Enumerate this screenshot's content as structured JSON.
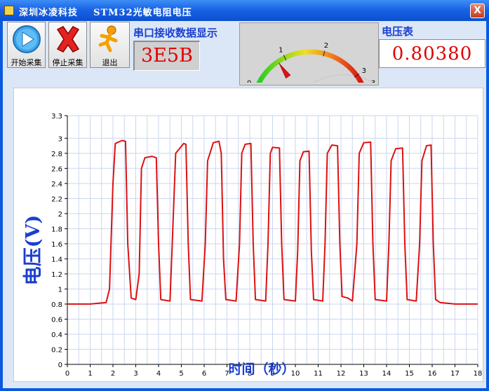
{
  "window": {
    "title": "深圳冰凌科技    STM32光敏电阻电压",
    "close_label": "X"
  },
  "toolbar": {
    "start_label": "开始采集",
    "stop_label": "停止采集",
    "exit_label": "退出"
  },
  "serial": {
    "heading": "串口接收数据显示",
    "value": "3E5B"
  },
  "meter": {
    "ticks": [
      "0",
      "1",
      "2",
      "3",
      "3.3"
    ],
    "min": 0,
    "max": 3.3,
    "value": 0.8038
  },
  "voltage": {
    "heading": "电压表",
    "value": "0.80380"
  },
  "colors": {
    "trace": "#dd1111",
    "axis_title": "#1a3fcf",
    "value_text": "#e10000"
  },
  "chart_data": {
    "type": "line",
    "xlabel": "时间（秒）",
    "ylabel": "电压(V)",
    "xlim": [
      0,
      18
    ],
    "ylim": [
      0,
      3.3
    ],
    "x_ticks": [
      "0",
      "1",
      "2",
      "3",
      "4",
      "5",
      "6",
      "7",
      "8",
      "9",
      "10",
      "11",
      "12",
      "13",
      "14",
      "15",
      "16",
      "17",
      "18"
    ],
    "y_ticks": [
      "0",
      "0.2",
      "0.4",
      "0.6",
      "0.8",
      "1",
      "1.2",
      "1.4",
      "1.6",
      "1.8",
      "2",
      "2.2",
      "2.4",
      "2.6",
      "2.8",
      "3",
      "3.3"
    ],
    "grid": true,
    "series": [
      {
        "points": [
          [
            0,
            0.8
          ],
          [
            1.0,
            0.8
          ],
          [
            1.7,
            0.82
          ],
          [
            1.85,
            1.0
          ],
          [
            2.0,
            2.4
          ],
          [
            2.1,
            2.93
          ],
          [
            2.4,
            2.97
          ],
          [
            2.55,
            2.96
          ],
          [
            2.65,
            1.6
          ],
          [
            2.8,
            0.88
          ],
          [
            3.0,
            0.86
          ],
          [
            3.15,
            1.2
          ],
          [
            3.25,
            2.6
          ],
          [
            3.4,
            2.74
          ],
          [
            3.7,
            2.76
          ],
          [
            3.9,
            2.74
          ],
          [
            4.0,
            1.6
          ],
          [
            4.1,
            0.86
          ],
          [
            4.5,
            0.84
          ],
          [
            4.6,
            1.6
          ],
          [
            4.75,
            2.8
          ],
          [
            5.1,
            2.93
          ],
          [
            5.2,
            2.92
          ],
          [
            5.3,
            1.6
          ],
          [
            5.4,
            0.86
          ],
          [
            5.9,
            0.84
          ],
          [
            6.05,
            1.6
          ],
          [
            6.15,
            2.7
          ],
          [
            6.4,
            2.94
          ],
          [
            6.65,
            2.96
          ],
          [
            6.75,
            2.8
          ],
          [
            6.85,
            1.4
          ],
          [
            6.95,
            0.86
          ],
          [
            7.4,
            0.84
          ],
          [
            7.55,
            1.6
          ],
          [
            7.65,
            2.8
          ],
          [
            7.8,
            2.92
          ],
          [
            8.05,
            2.93
          ],
          [
            8.15,
            1.6
          ],
          [
            8.25,
            0.86
          ],
          [
            8.7,
            0.84
          ],
          [
            8.8,
            1.6
          ],
          [
            8.9,
            2.8
          ],
          [
            9.0,
            2.88
          ],
          [
            9.3,
            2.87
          ],
          [
            9.4,
            1.6
          ],
          [
            9.5,
            0.86
          ],
          [
            10.0,
            0.84
          ],
          [
            10.1,
            1.5
          ],
          [
            10.2,
            2.7
          ],
          [
            10.35,
            2.82
          ],
          [
            10.6,
            2.83
          ],
          [
            10.7,
            1.5
          ],
          [
            10.8,
            0.86
          ],
          [
            11.2,
            0.84
          ],
          [
            11.3,
            1.6
          ],
          [
            11.4,
            2.8
          ],
          [
            11.6,
            2.91
          ],
          [
            11.85,
            2.9
          ],
          [
            11.95,
            1.6
          ],
          [
            12.05,
            0.9
          ],
          [
            12.3,
            0.88
          ],
          [
            12.5,
            0.84
          ],
          [
            12.7,
            1.6
          ],
          [
            12.8,
            2.8
          ],
          [
            13.0,
            2.94
          ],
          [
            13.3,
            2.95
          ],
          [
            13.4,
            1.6
          ],
          [
            13.5,
            0.86
          ],
          [
            14.0,
            0.84
          ],
          [
            14.1,
            1.6
          ],
          [
            14.2,
            2.7
          ],
          [
            14.4,
            2.86
          ],
          [
            14.7,
            2.87
          ],
          [
            14.8,
            1.6
          ],
          [
            14.9,
            0.86
          ],
          [
            15.3,
            0.84
          ],
          [
            15.45,
            1.6
          ],
          [
            15.55,
            2.7
          ],
          [
            15.75,
            2.9
          ],
          [
            15.95,
            2.91
          ],
          [
            16.05,
            1.6
          ],
          [
            16.15,
            0.86
          ],
          [
            16.35,
            0.82
          ],
          [
            17.0,
            0.8
          ],
          [
            18.0,
            0.8
          ]
        ]
      }
    ]
  }
}
